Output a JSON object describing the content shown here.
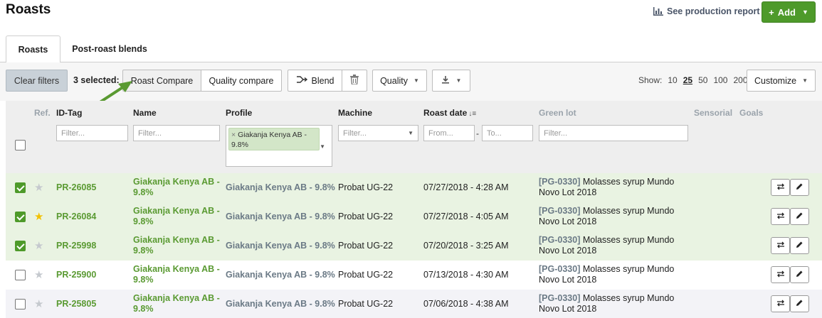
{
  "page": {
    "title": "Roasts"
  },
  "header": {
    "report_link": "See production report",
    "add_label": "Add"
  },
  "tabs": [
    {
      "label": "Roasts"
    },
    {
      "label": "Post-roast blends"
    }
  ],
  "toolbar": {
    "clear_filters": "Clear filters",
    "selected_text": "3 selected:",
    "roast_compare": "Roast Compare",
    "quality_compare": "Quality compare",
    "blend": "Blend",
    "quality": "Quality",
    "show_label": "Show:",
    "show_options": [
      "10",
      "25",
      "50",
      "100",
      "200"
    ],
    "show_selected": "25",
    "customize": "Customize"
  },
  "columns": {
    "ref": "Ref.",
    "id_tag": "ID-Tag",
    "name": "Name",
    "profile": "Profile",
    "machine": "Machine",
    "roast_date": "Roast date",
    "green_lot": "Green lot",
    "sensorial": "Sensorial",
    "goals": "Goals"
  },
  "filters": {
    "id_placeholder": "Filter...",
    "name_placeholder": "Filter...",
    "profile_chip": "Giakanja Kenya AB - 9.8%",
    "machine_placeholder": "Filter...",
    "date_from": "From...",
    "date_to": "To...",
    "lot_placeholder": "Filter..."
  },
  "rows": [
    {
      "checked": true,
      "starred": false,
      "id": "PR-26085",
      "name": "Giakanja Kenya AB - 9.8%",
      "profile": "Giakanja Kenya AB - 9.8%",
      "machine": "Probat UG-22",
      "date": "07/27/2018 - 4:28 AM",
      "lot_code": "[PG-0330]",
      "lot_name": "Molasses syrup Mundo Novo Lot 2018"
    },
    {
      "checked": true,
      "starred": true,
      "id": "PR-26084",
      "name": "Giakanja Kenya AB - 9.8%",
      "profile": "Giakanja Kenya AB - 9.8%",
      "machine": "Probat UG-22",
      "date": "07/27/2018 - 4:05 AM",
      "lot_code": "[PG-0330]",
      "lot_name": "Molasses syrup Mundo Novo Lot 2018"
    },
    {
      "checked": true,
      "starred": false,
      "id": "PR-25998",
      "name": "Giakanja Kenya AB - 9.8%",
      "profile": "Giakanja Kenya AB - 9.8%",
      "machine": "Probat UG-22",
      "date": "07/20/2018 - 3:25 AM",
      "lot_code": "[PG-0330]",
      "lot_name": "Molasses syrup Mundo Novo Lot 2018"
    },
    {
      "checked": false,
      "starred": false,
      "id": "PR-25900",
      "name": "Giakanja Kenya AB - 9.8%",
      "profile": "Giakanja Kenya AB - 9.8%",
      "machine": "Probat UG-22",
      "date": "07/13/2018 - 4:30 AM",
      "lot_code": "[PG-0330]",
      "lot_name": "Molasses syrup Mundo Novo Lot 2018"
    },
    {
      "checked": false,
      "starred": false,
      "id": "PR-25805",
      "name": "Giakanja Kenya AB - 9.8%",
      "profile": "Giakanja Kenya AB - 9.8%",
      "machine": "Probat UG-22",
      "date": "07/06/2018 - 4:38 AM",
      "lot_code": "[PG-0330]",
      "lot_name": "Molasses syrup Mundo Novo Lot 2018"
    }
  ],
  "colors": {
    "accent_green": "#4e9a2a",
    "selected_row": "#e9f3e2",
    "star_gold": "#f2c100",
    "arrow_green": "#5a9a32"
  }
}
